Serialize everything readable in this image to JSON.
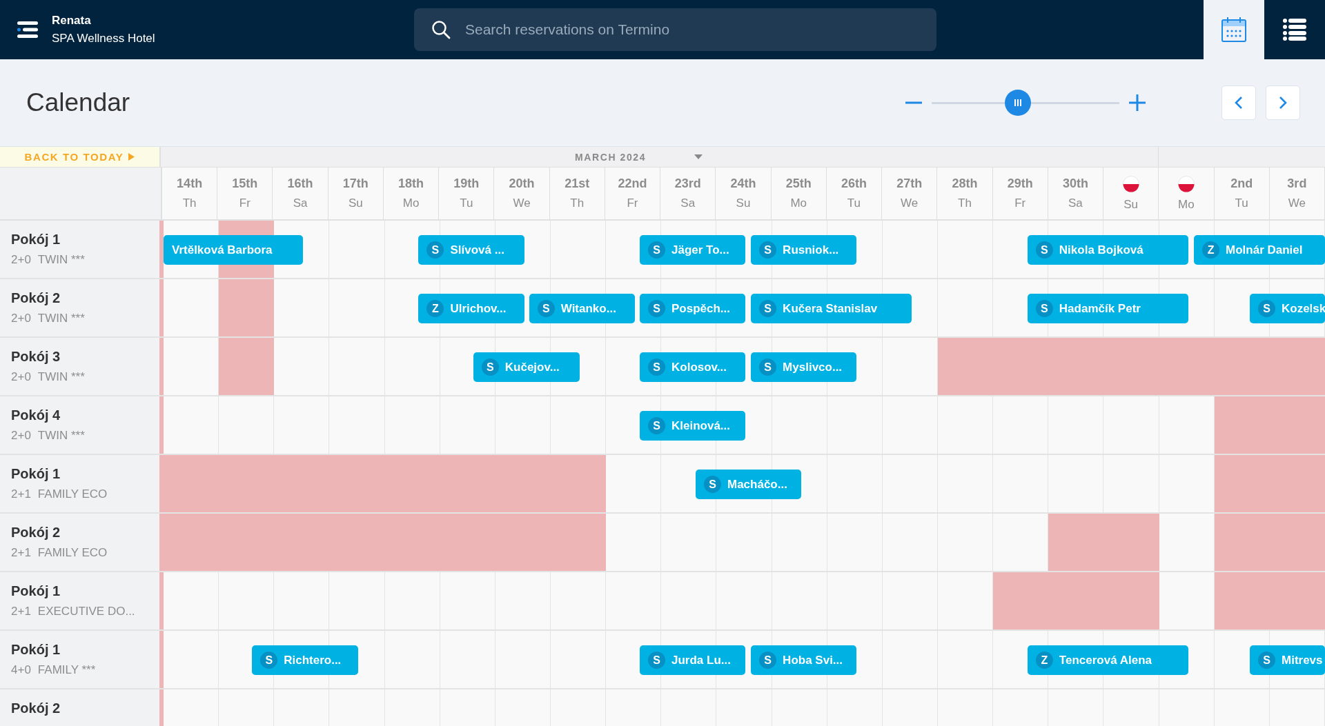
{
  "header": {
    "user": "Renata",
    "hotel": "SPA Wellness Hotel",
    "search": {
      "placeholder": "Search reservations on Termino"
    },
    "views": [
      {
        "kind": "calendar",
        "selected": true
      },
      {
        "kind": "list",
        "selected": false
      }
    ]
  },
  "title": "Calendar",
  "zoom": {
    "level": 0.46
  },
  "back_to_today": "BACK TO TODAY",
  "month": "MARCH 2024",
  "days": [
    {
      "date": "14th",
      "day": "Th"
    },
    {
      "date": "15th",
      "day": "Fr"
    },
    {
      "date": "16th",
      "day": "Sa"
    },
    {
      "date": "17th",
      "day": "Su"
    },
    {
      "date": "18th",
      "day": "Mo"
    },
    {
      "date": "19th",
      "day": "Tu"
    },
    {
      "date": "20th",
      "day": "We"
    },
    {
      "date": "21st",
      "day": "Th"
    },
    {
      "date": "22nd",
      "day": "Fr"
    },
    {
      "date": "23rd",
      "day": "Sa"
    },
    {
      "date": "24th",
      "day": "Su"
    },
    {
      "date": "25th",
      "day": "Mo"
    },
    {
      "date": "26th",
      "day": "Tu"
    },
    {
      "date": "27th",
      "day": "We"
    },
    {
      "date": "28th",
      "day": "Th"
    },
    {
      "date": "29th",
      "day": "Fr"
    },
    {
      "date": "30th",
      "day": "Sa"
    },
    {
      "kind": "holiday",
      "day": "Su"
    },
    {
      "kind": "holiday",
      "day": "Mo"
    },
    {
      "date": "2nd",
      "day": "Tu"
    },
    {
      "date": "3rd",
      "day": "We"
    }
  ],
  "rooms": [
    {
      "room": "Pokój 1",
      "occupancy": "2+0",
      "type": "TWIN ***",
      "cells": [
        {
          "blocked": false
        },
        {
          "blocked": true
        },
        {
          "blocked": false
        },
        {
          "blocked": false
        },
        {
          "blocked": false
        },
        {
          "blocked": false
        },
        {
          "blocked": false
        },
        {
          "blocked": false
        },
        {
          "blocked": false
        },
        {
          "blocked": false
        },
        {
          "blocked": false
        },
        {
          "blocked": false
        },
        {
          "blocked": false
        },
        {
          "blocked": false
        },
        {
          "blocked": false
        },
        {
          "blocked": false
        },
        {
          "blocked": false
        },
        {
          "blocked": false
        },
        {
          "blocked": false
        },
        {
          "blocked": false
        },
        {
          "blocked": false
        }
      ],
      "bookings": [
        {
          "guest": "Vrtělková Barbora"
        },
        {
          "badge": "S",
          "guest": "Slívová ..."
        },
        {
          "badge": "S",
          "guest": "Jäger To..."
        },
        {
          "badge": "S",
          "guest": "Rusniok..."
        },
        {
          "badge": "S",
          "guest": "Nikola Bojková"
        },
        {
          "badge": "Z",
          "guest": "Molnár Daniel"
        }
      ]
    },
    {
      "room": "Pokój 2",
      "occupancy": "2+0",
      "type": "TWIN ***",
      "cells": [
        {
          "blocked": false
        },
        {
          "blocked": true
        },
        {
          "blocked": false
        },
        {
          "blocked": false
        },
        {
          "blocked": false
        },
        {
          "blocked": false
        },
        {
          "blocked": false
        },
        {
          "blocked": false
        },
        {
          "blocked": false
        },
        {
          "blocked": false
        },
        {
          "blocked": false
        },
        {
          "blocked": false
        },
        {
          "blocked": false
        },
        {
          "blocked": false
        },
        {
          "blocked": false
        },
        {
          "blocked": false
        },
        {
          "blocked": false
        },
        {
          "blocked": false
        },
        {
          "blocked": false
        },
        {
          "blocked": false
        },
        {
          "blocked": false
        }
      ],
      "bookings": [
        {
          "badge": "Z",
          "guest": "Ulrichov..."
        },
        {
          "badge": "S",
          "guest": "Witanko..."
        },
        {
          "badge": "S",
          "guest": "Pospěch..."
        },
        {
          "badge": "S",
          "guest": "Kučera Stanislav"
        },
        {
          "badge": "S",
          "guest": "Hadamčík Petr"
        },
        {
          "badge": "S",
          "guest": "Kozelsk"
        }
      ]
    },
    {
      "room": "Pokój 3",
      "occupancy": "2+0",
      "type": "TWIN ***",
      "cells": [
        {
          "blocked": false
        },
        {
          "blocked": true
        },
        {
          "blocked": false
        },
        {
          "blocked": false
        },
        {
          "blocked": false
        },
        {
          "blocked": false
        },
        {
          "blocked": false
        },
        {
          "blocked": false
        },
        {
          "blocked": false
        },
        {
          "blocked": false
        },
        {
          "blocked": false
        },
        {
          "blocked": false
        },
        {
          "blocked": false
        },
        {
          "blocked": false
        },
        {
          "blocked": true
        },
        {
          "blocked": true
        },
        {
          "blocked": true
        },
        {
          "blocked": true
        },
        {
          "blocked": true
        },
        {
          "blocked": true
        },
        {
          "blocked": true
        }
      ],
      "bookings": [
        {
          "badge": "S",
          "guest": "Kučejov..."
        },
        {
          "badge": "S",
          "guest": "Kolosov..."
        },
        {
          "badge": "S",
          "guest": "Myslivco..."
        }
      ]
    },
    {
      "room": "Pokój 4",
      "occupancy": "2+0",
      "type": "TWIN ***",
      "cells": [
        {
          "blocked": false
        },
        {
          "blocked": false
        },
        {
          "blocked": false
        },
        {
          "blocked": false
        },
        {
          "blocked": false
        },
        {
          "blocked": false
        },
        {
          "blocked": false
        },
        {
          "blocked": false
        },
        {
          "blocked": false
        },
        {
          "blocked": false
        },
        {
          "blocked": false
        },
        {
          "blocked": false
        },
        {
          "blocked": false
        },
        {
          "blocked": false
        },
        {
          "blocked": false
        },
        {
          "blocked": false
        },
        {
          "blocked": false
        },
        {
          "blocked": false
        },
        {
          "blocked": false
        },
        {
          "blocked": true
        },
        {
          "blocked": true
        }
      ],
      "bookings": [
        {
          "badge": "S",
          "guest": "Kleinová..."
        }
      ]
    },
    {
      "room": "Pokój 1",
      "occupancy": "2+1",
      "type": "FAMILY ECO",
      "cells": [
        {
          "blocked": true
        },
        {
          "blocked": true
        },
        {
          "blocked": true
        },
        {
          "blocked": true
        },
        {
          "blocked": true
        },
        {
          "blocked": true
        },
        {
          "blocked": true
        },
        {
          "blocked": true
        },
        {
          "blocked": false
        },
        {
          "blocked": false
        },
        {
          "blocked": false
        },
        {
          "blocked": false
        },
        {
          "blocked": false
        },
        {
          "blocked": false
        },
        {
          "blocked": false
        },
        {
          "blocked": false
        },
        {
          "blocked": false
        },
        {
          "blocked": false
        },
        {
          "blocked": false
        },
        {
          "blocked": true
        },
        {
          "blocked": true
        }
      ],
      "bookings": [
        {
          "badge": "S",
          "guest": "Macháčo..."
        }
      ]
    },
    {
      "room": "Pokój 2",
      "occupancy": "2+1",
      "type": "FAMILY ECO",
      "cells": [
        {
          "blocked": true
        },
        {
          "blocked": true
        },
        {
          "blocked": true
        },
        {
          "blocked": true
        },
        {
          "blocked": true
        },
        {
          "blocked": true
        },
        {
          "blocked": true
        },
        {
          "blocked": true
        },
        {
          "blocked": false
        },
        {
          "blocked": false
        },
        {
          "blocked": false
        },
        {
          "blocked": false
        },
        {
          "blocked": false
        },
        {
          "blocked": false
        },
        {
          "blocked": false
        },
        {
          "blocked": false
        },
        {
          "blocked": true
        },
        {
          "blocked": true
        },
        {
          "blocked": false
        },
        {
          "blocked": true
        },
        {
          "blocked": true
        }
      ]
    },
    {
      "room": "Pokój 1",
      "occupancy": "2+1",
      "type": "EXECUTIVE DO...",
      "cells": [
        {
          "blocked": false
        },
        {
          "blocked": false
        },
        {
          "blocked": false
        },
        {
          "blocked": false
        },
        {
          "blocked": false
        },
        {
          "blocked": false
        },
        {
          "blocked": false
        },
        {
          "blocked": false
        },
        {
          "blocked": false
        },
        {
          "blocked": false
        },
        {
          "blocked": false
        },
        {
          "blocked": false
        },
        {
          "blocked": false
        },
        {
          "blocked": false
        },
        {
          "blocked": false
        },
        {
          "blocked": true
        },
        {
          "blocked": true
        },
        {
          "blocked": true
        },
        {
          "blocked": false
        },
        {
          "blocked": true
        },
        {
          "blocked": true
        }
      ]
    },
    {
      "room": "Pokój 1",
      "occupancy": "4+0",
      "type": "FAMILY ***",
      "cells": [
        {
          "blocked": false
        },
        {
          "blocked": false
        },
        {
          "blocked": false
        },
        {
          "blocked": false
        },
        {
          "blocked": false
        },
        {
          "blocked": false
        },
        {
          "blocked": false
        },
        {
          "blocked": false
        },
        {
          "blocked": false
        },
        {
          "blocked": false
        },
        {
          "blocked": false
        },
        {
          "blocked": false
        },
        {
          "blocked": false
        },
        {
          "blocked": false
        },
        {
          "blocked": false
        },
        {
          "blocked": false
        },
        {
          "blocked": false
        },
        {
          "blocked": false
        },
        {
          "blocked": false
        },
        {
          "blocked": false
        },
        {
          "blocked": false
        }
      ],
      "bookings": [
        {
          "badge": "S",
          "guest": "Richtero..."
        },
        {
          "badge": "S",
          "guest": "Jurda Lu..."
        },
        {
          "badge": "S",
          "guest": "Hoba Svi..."
        },
        {
          "badge": "Z",
          "guest": "Tencerová Alena"
        },
        {
          "badge": "S",
          "guest": "Mitrevs"
        }
      ]
    },
    {
      "room": "Pokój 2",
      "cells": [
        {
          "blocked": false
        },
        {
          "blocked": false
        },
        {
          "blocked": false
        },
        {
          "blocked": false
        },
        {
          "blocked": false
        },
        {
          "blocked": false
        },
        {
          "blocked": false
        },
        {
          "blocked": false
        },
        {
          "blocked": false
        },
        {
          "blocked": false
        },
        {
          "blocked": false
        },
        {
          "blocked": false
        },
        {
          "blocked": false
        },
        {
          "blocked": false
        },
        {
          "blocked": false
        },
        {
          "blocked": false
        },
        {
          "blocked": false
        },
        {
          "blocked": false
        },
        {
          "blocked": false
        },
        {
          "blocked": false
        },
        {
          "blocked": false
        }
      ]
    }
  ]
}
